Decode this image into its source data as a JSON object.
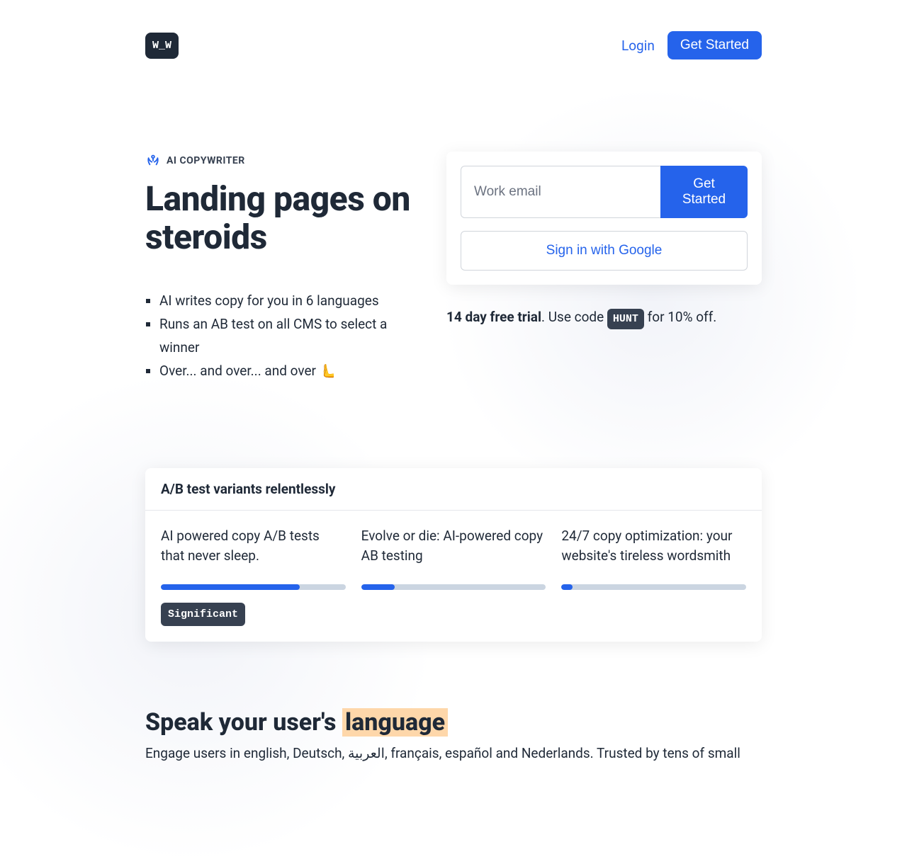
{
  "nav": {
    "logo": "W_W",
    "login": "Login",
    "get_started": "Get Started"
  },
  "hero": {
    "eyebrow": "AI COPYWRITER",
    "title": "Landing pages on steroids",
    "bullets": [
      "AI writes copy for you in 6 languages",
      "Runs an AB test on all CMS to select a winner",
      "Over... and over... and over 🫷"
    ]
  },
  "signup": {
    "email_placeholder": "Work email",
    "cta": "Get Started",
    "google": "Sign in with Google",
    "trial_bold": "14 day free trial",
    "trial_mid": ". Use code ",
    "code": "HUNT",
    "trial_end": " for 10% off."
  },
  "abtest": {
    "title": "A/B test variants relentlessly",
    "variants": [
      {
        "text": "AI powered copy A/B tests that never sleep.",
        "progress": 75
      },
      {
        "text": "Evolve or die: AI-powered copy AB testing",
        "progress": 18
      },
      {
        "text": "24/7 copy optimization: your website's tireless wordsmith",
        "progress": 6
      }
    ],
    "badge": "Significant"
  },
  "section2": {
    "title_pre": "Speak your user's ",
    "title_hl": "language",
    "sub": "Engage users in english, Deutsch, العربية, français, español and Nederlands. Trusted by tens of small"
  }
}
